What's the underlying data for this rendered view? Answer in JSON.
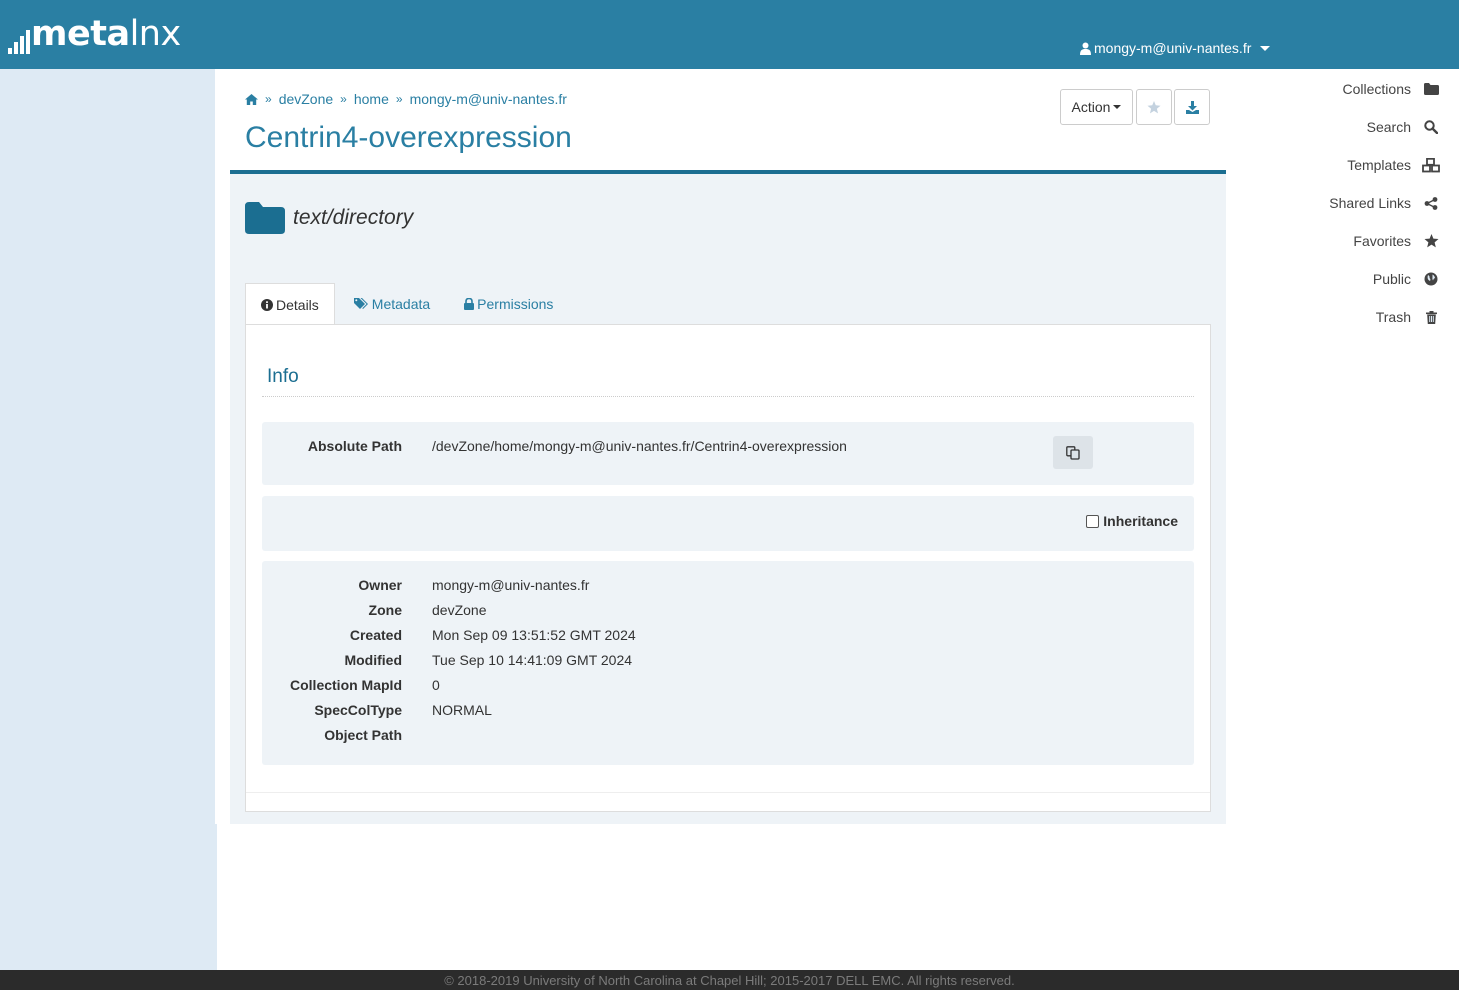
{
  "app": {
    "logo_bold": "meta",
    "logo_light": "lnx"
  },
  "user_menu": {
    "user": "mongy-m@univ-nantes.fr",
    "icon": "user-icon"
  },
  "sidebar": {
    "items": [
      {
        "label": "Collections",
        "icon": "folder-icon"
      },
      {
        "label": "Search",
        "icon": "search-icon"
      },
      {
        "label": "Templates",
        "icon": "cubes-icon"
      },
      {
        "label": "Shared Links",
        "icon": "share-icon"
      },
      {
        "label": "Favorites",
        "icon": "star-icon"
      },
      {
        "label": "Public",
        "icon": "globe-icon"
      },
      {
        "label": "Trash",
        "icon": "trash-icon"
      }
    ]
  },
  "breadcrumb": {
    "items": [
      "devZone",
      "home",
      "mongy-m@univ-nantes.fr"
    ]
  },
  "page": {
    "title": "Centrin4-overexpression",
    "mime_type": "text/directory"
  },
  "toolbar": {
    "action_label": "Action"
  },
  "tabs": [
    {
      "label": "Details",
      "icon": "info-circle-icon"
    },
    {
      "label": "Metadata",
      "icon": "tags-icon"
    },
    {
      "label": "Permissions",
      "icon": "lock-icon"
    }
  ],
  "info": {
    "title": "Info",
    "absolute_path_label": "Absolute Path",
    "absolute_path": "/devZone/home/mongy-m@univ-nantes.fr/Centrin4-overexpression",
    "inheritance_label": "Inheritance",
    "fields": [
      {
        "label": "Owner",
        "value": "mongy-m@univ-nantes.fr"
      },
      {
        "label": "Zone",
        "value": "devZone"
      },
      {
        "label": "Created",
        "value": "Mon Sep 09 13:51:52 GMT 2024"
      },
      {
        "label": "Modified",
        "value": "Tue Sep 10 14:41:09 GMT 2024"
      },
      {
        "label": "Collection MapId",
        "value": "0"
      },
      {
        "label": "SpecColType",
        "value": "NORMAL"
      },
      {
        "label": "Object Path",
        "value": ""
      }
    ]
  },
  "footer": {
    "text": "© 2018-2019 University of North Carolina at Chapel Hill; 2015-2017 DELL EMC. All rights reserved."
  },
  "colors": {
    "brand": "#2a7fa3",
    "sidebar_bg": "#deeaf4",
    "panel_bg": "#eef3f7",
    "footer_bg": "#2b2b2b"
  }
}
